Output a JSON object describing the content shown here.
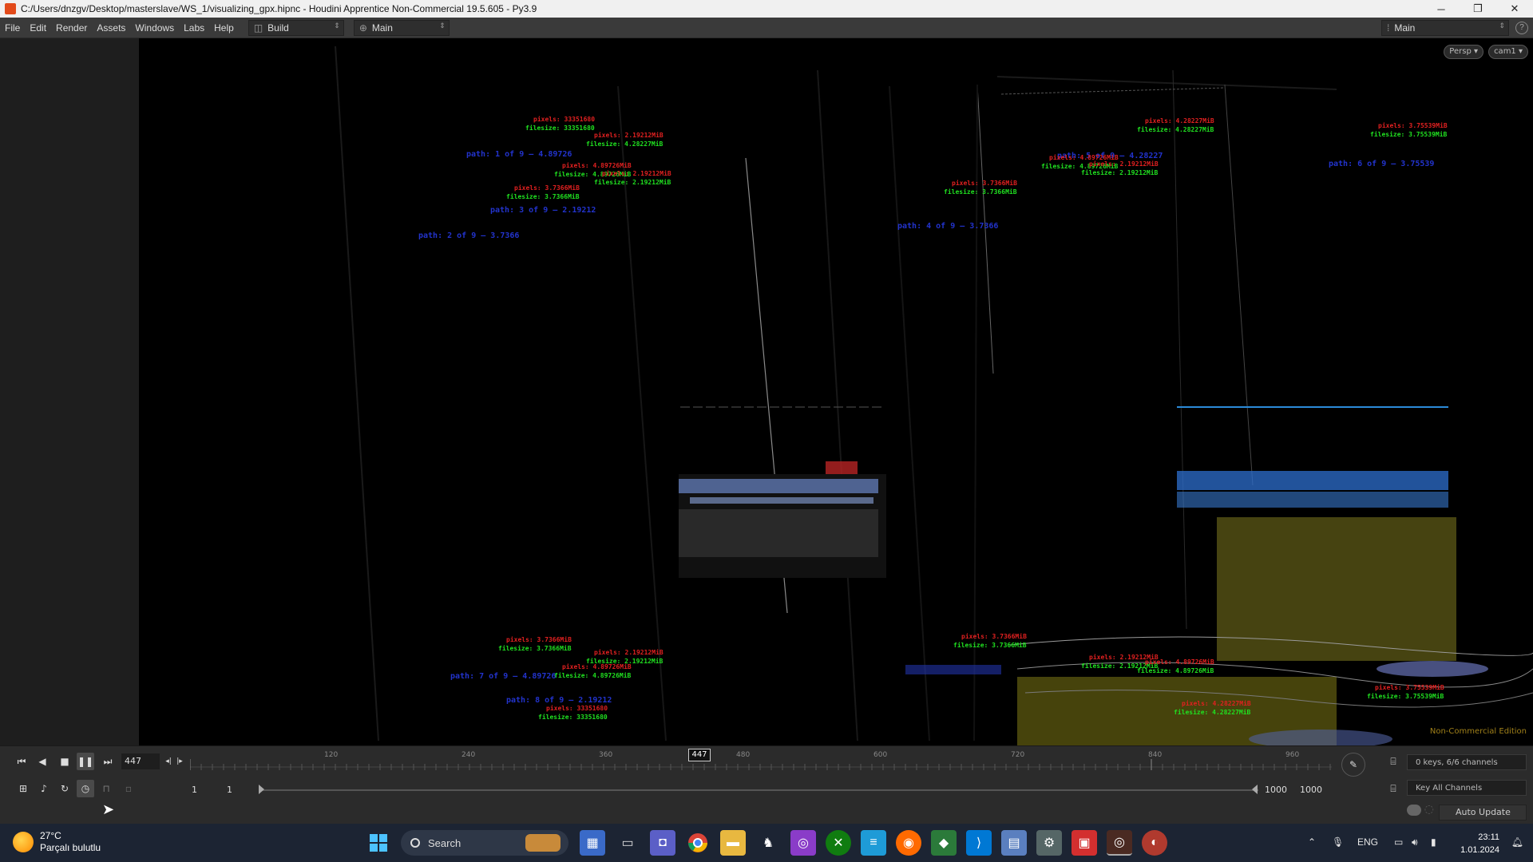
{
  "window": {
    "title": "C:/Users/dnzgv/Desktop/masterslave/WS_1/visualizing_gpx.hipnc - Houdini Apprentice Non-Commercial 19.5.605 - Py3.9",
    "minimize": "─",
    "maximize": "❐",
    "close": "✕"
  },
  "menu": {
    "items": [
      "File",
      "Edit",
      "Render",
      "Assets",
      "Windows",
      "Labs",
      "Help"
    ],
    "desktop_build": "Build",
    "desktop_main": "Main",
    "desktop_right": "Main",
    "help_icon": "?"
  },
  "viewport": {
    "persp_button": "Persp ▾",
    "cam_button": "cam1 ▾",
    "watermark": "Non-Commercial Edition",
    "labels": [
      {
        "red": "pixels: 33351680",
        "green": "filesize: 33351680"
      },
      {
        "red": "pixels: 2.19212MiB",
        "green": "filesize: 4.28227MiB"
      },
      {
        "red": "pixels: 4.89726MiB",
        "green": "filesize: 4.89726MiB"
      },
      {
        "red": "pixels: 2.19212MiB",
        "green": "filesize: 2.19212MiB"
      },
      {
        "red": "pixels: 3.7366MiB",
        "green": "filesize: 3.7366MiB"
      },
      {
        "red": "pixels: 4.28227MiB",
        "green": "filesize: 4.28227MiB"
      },
      {
        "red": "pixels: 4.89726MiB",
        "green": "filesize: 4.89726MiB"
      },
      {
        "red": "pixels: 2.19212MiB",
        "green": "filesize: 2.19212MiB"
      },
      {
        "red": "pixels: 3.7366MiB",
        "green": "filesize: 3.7366MiB"
      },
      {
        "red": "pixels: 3.75539MiB",
        "green": "filesize: 3.75539MiB"
      },
      {
        "red": "pixels: 3.7366MiB",
        "green": "filesize: 3.7366MiB"
      },
      {
        "red": "pixels: 2.19212MiB",
        "green": "filesize: 2.19212MiB"
      },
      {
        "red": "pixels: 4.89726MiB",
        "green": "filesize: 4.89726MiB"
      },
      {
        "red": "pixels: 33351680",
        "green": "filesize: 33351680"
      },
      {
        "red": "pixels: 3.7366MiB",
        "green": "filesize: 3.7366MiB"
      },
      {
        "red": "pixels: 2.19212MiB",
        "green": "filesize: 2.19212MiB"
      },
      {
        "red": "pixels: 4.89726MiB",
        "green": "filesize: 4.89726MiB"
      },
      {
        "red": "pixels: 4.28227MiB",
        "green": "filesize: 4.28227MiB"
      },
      {
        "red": "pixels: 3.75539MiB",
        "green": "filesize: 3.75539MiB"
      }
    ]
  },
  "playbar": {
    "current_frame": "447",
    "frame_marker": "447",
    "ticks": [
      "120",
      "240",
      "360",
      "480",
      "600",
      "720",
      "840",
      "960"
    ],
    "start_frame": "1",
    "start_frame_2": "1",
    "end_frame": "1000",
    "end_frame_2": "1000",
    "keys_info": "0 keys, 6/6 channels",
    "key_all": "Key All Channels",
    "auto_update": "Auto Update"
  },
  "taskbar": {
    "temperature": "27°C",
    "weather": "Parçalı bulutlu",
    "search": "Search",
    "language": "ENG",
    "time": "23:11",
    "date": "1.01.2024"
  }
}
